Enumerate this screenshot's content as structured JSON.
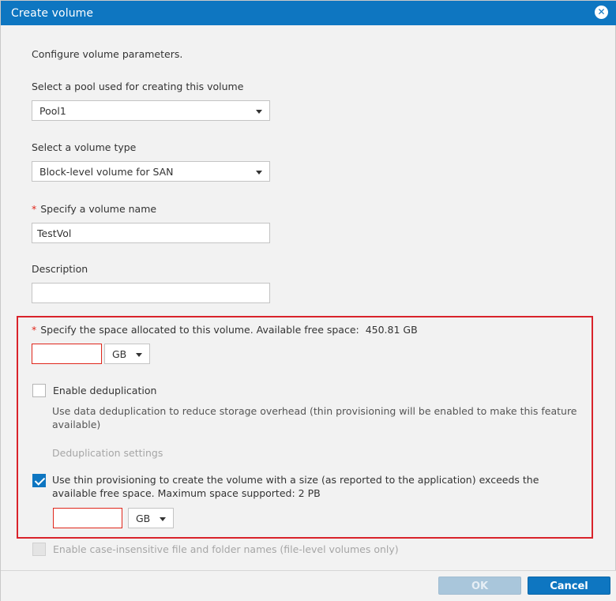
{
  "dialog": {
    "title": "Create volume",
    "intro": "Configure volume parameters."
  },
  "pool": {
    "label": "Select a pool used for creating this volume",
    "value": "Pool1"
  },
  "volume_type": {
    "label": "Select a volume type",
    "value": "Block-level volume for SAN"
  },
  "volume_name": {
    "required_mark": "*",
    "label": "Specify a volume name",
    "value": "TestVol"
  },
  "description": {
    "label": "Description",
    "value": ""
  },
  "space": {
    "required_mark": "*",
    "label": "Specify the space allocated to this volume. Available free space:",
    "free_space": "450.81 GB",
    "value": "",
    "unit": "GB"
  },
  "dedup": {
    "label": "Enable deduplication",
    "checked": false,
    "description": "Use data deduplication to reduce storage overhead (thin provisioning will be enabled to make this feature available)",
    "settings_link": "Deduplication settings"
  },
  "thin": {
    "label": "Use thin provisioning to create the volume with a size (as reported to the application) exceeds the available free space. Maximum space supported: 2 PB",
    "checked": true,
    "value": "",
    "unit": "GB"
  },
  "case_insensitive": {
    "label": "Enable case-insensitive file and folder names (file-level volumes only)",
    "checked": false,
    "disabled": true
  },
  "footer": {
    "ok_label": "OK",
    "cancel_label": "Cancel"
  },
  "colors": {
    "titlebar": "#0e76c1",
    "error": "#e0271c",
    "highlight": "#d9232b"
  }
}
